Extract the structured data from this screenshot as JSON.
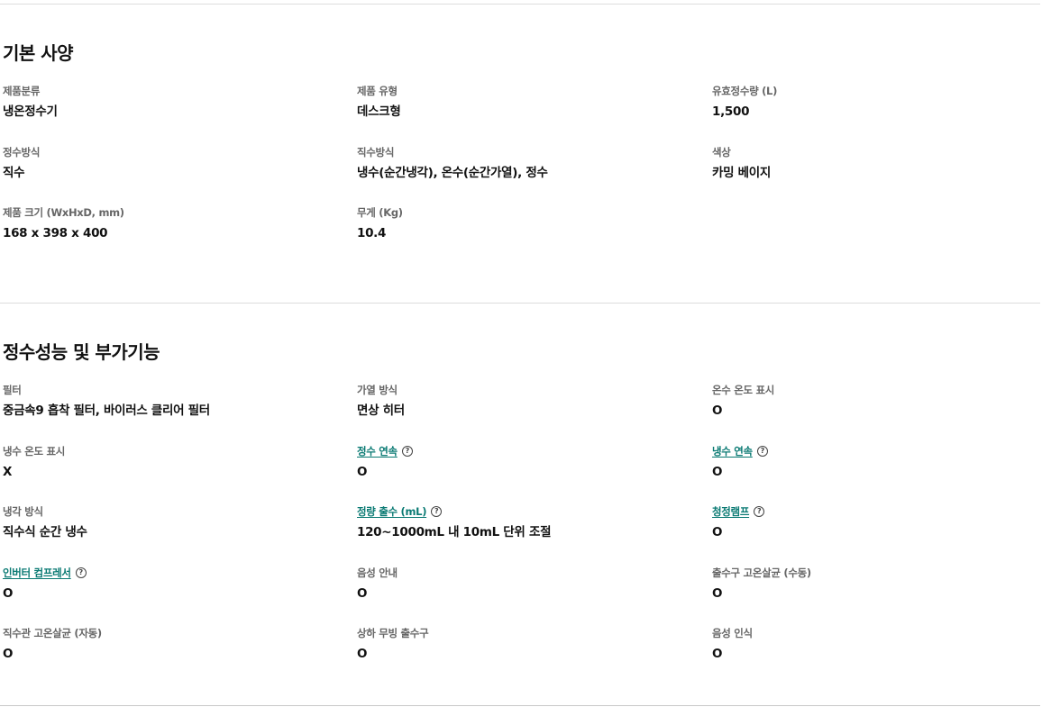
{
  "basic_spec": {
    "title": "기본 사양",
    "items": [
      {
        "label": "제품분류",
        "value": "냉온정수기"
      },
      {
        "label": "제품 유형",
        "value": "데스크형"
      },
      {
        "label": "유효정수량 (L)",
        "value": "1,500"
      },
      {
        "label": "정수방식",
        "value": "직수"
      },
      {
        "label": "직수방식",
        "value": "냉수(순간냉각), 온수(순간가열), 정수"
      },
      {
        "label": "색상",
        "value": "카밍 베이지"
      },
      {
        "label": "제품 크기 (WxHxD, mm)",
        "value": "168 x 398 x 400"
      },
      {
        "label": "무게 (Kg)",
        "value": "10.4"
      }
    ]
  },
  "performance": {
    "title": "정수성능 및 부가기능",
    "items": [
      {
        "label": "필터",
        "value": "중금속9 흡착 필터, 바이러스 클리어 필터",
        "link": false
      },
      {
        "label": "가열 방식",
        "value": "면상 히터",
        "link": false
      },
      {
        "label": "온수 온도 표시",
        "value": "O",
        "link": false
      },
      {
        "label": "냉수 온도 표시",
        "value": "X",
        "link": false
      },
      {
        "label": "정수 연속",
        "value": "O",
        "link": true,
        "help_icon": "question-circle-icon"
      },
      {
        "label": "냉수 연속",
        "value": "O",
        "link": true,
        "help_icon": "question-circle-icon"
      },
      {
        "label": "냉각 방식",
        "value": "직수식 순간 냉수",
        "link": false
      },
      {
        "label": "정량 출수 (mL)",
        "value": "120~1000mL 내 10mL 단위 조절",
        "link": true,
        "help_icon": "question-circle-icon"
      },
      {
        "label": "청정램프",
        "value": "O",
        "link": true,
        "help_icon": "question-circle-icon"
      },
      {
        "label": "인버터 컴프레서",
        "value": "O",
        "link": true,
        "help_icon": "question-circle-icon"
      },
      {
        "label": "음성 안내",
        "value": "O",
        "link": false
      },
      {
        "label": "출수구 고온살균 (수동)",
        "value": "O",
        "link": false
      },
      {
        "label": "직수관 고온살균 (자동)",
        "value": "O",
        "link": false
      },
      {
        "label": "상하 무빙 출수구",
        "value": "O",
        "link": false
      },
      {
        "label": "음성 인식",
        "value": "O",
        "link": false
      }
    ]
  },
  "help_icon_glyph": "?",
  "colors": {
    "link": "#0a7a73",
    "label": "#666666",
    "value": "#111111",
    "divider": "#dddddd"
  }
}
